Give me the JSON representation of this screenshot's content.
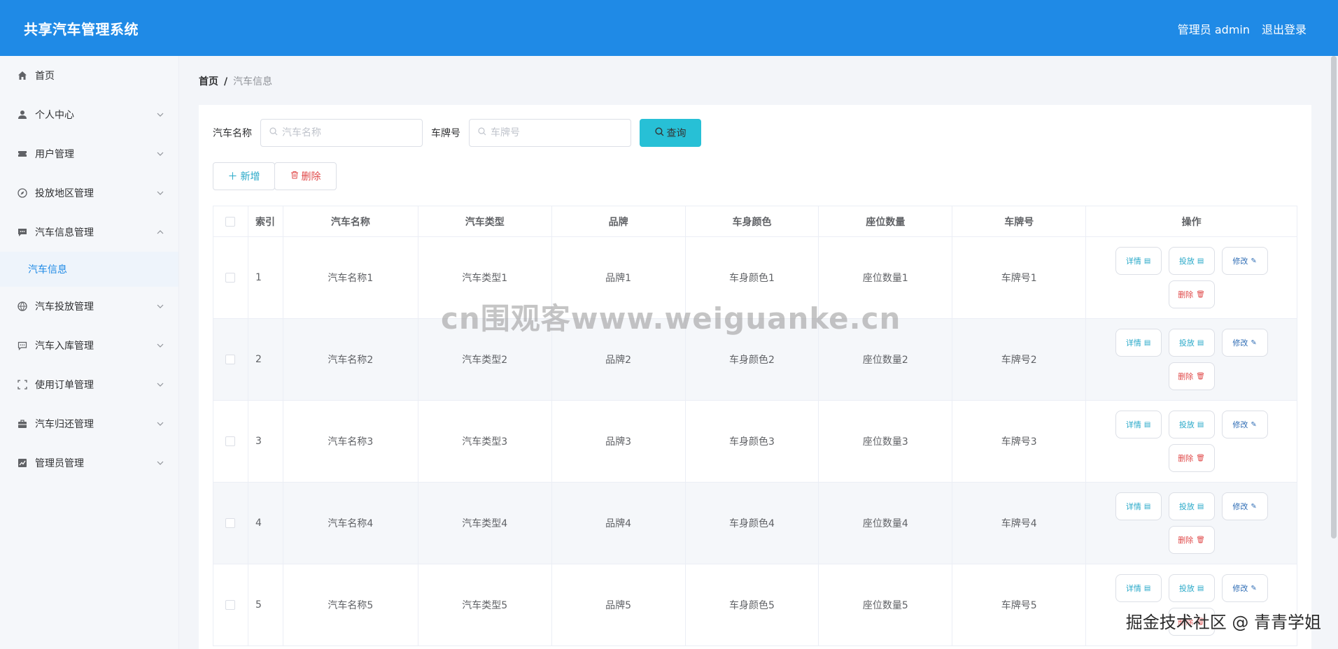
{
  "header": {
    "title": "共享汽车管理系统",
    "user_label": "管理员 admin",
    "logout_label": "退出登录"
  },
  "sidebar": {
    "items": [
      {
        "label": "首页",
        "icon": "home-icon",
        "has_children": false
      },
      {
        "label": "个人中心",
        "icon": "user-icon",
        "has_children": true
      },
      {
        "label": "用户管理",
        "icon": "ticket-icon",
        "has_children": true
      },
      {
        "label": "投放地区管理",
        "icon": "compass-icon",
        "has_children": true
      },
      {
        "label": "汽车信息管理",
        "icon": "chat-icon",
        "has_children": true,
        "expanded": true,
        "children": [
          {
            "label": "汽车信息",
            "active": true
          }
        ]
      },
      {
        "label": "汽车投放管理",
        "icon": "globe-icon",
        "has_children": true
      },
      {
        "label": "汽车入库管理",
        "icon": "comment-icon",
        "has_children": true
      },
      {
        "label": "使用订单管理",
        "icon": "fullscreen-icon",
        "has_children": true
      },
      {
        "label": "汽车归还管理",
        "icon": "briefcase-icon",
        "has_children": true
      },
      {
        "label": "管理员管理",
        "icon": "chart-icon",
        "has_children": true
      }
    ]
  },
  "breadcrumb": {
    "home": "首页",
    "separator": "/",
    "current": "汽车信息"
  },
  "search": {
    "name_label": "汽车名称",
    "name_placeholder": "汽车名称",
    "name_value": "",
    "plate_label": "车牌号",
    "plate_placeholder": "车牌号",
    "plate_value": "",
    "query_label": "查询"
  },
  "actions": {
    "add_label": "新增",
    "delete_label": "删除"
  },
  "table": {
    "columns": [
      "索引",
      "汽车名称",
      "汽车类型",
      "品牌",
      "车身颜色",
      "座位数量",
      "车牌号",
      "操作"
    ],
    "op_labels": {
      "detail": "详情",
      "put": "投放",
      "edit": "修改",
      "remove": "删除"
    },
    "rows": [
      {
        "index": "1",
        "name": "汽车名称1",
        "type": "汽车类型1",
        "brand": "品牌1",
        "color": "车身颜色1",
        "seats": "座位数量1",
        "plate": "车牌号1"
      },
      {
        "index": "2",
        "name": "汽车名称2",
        "type": "汽车类型2",
        "brand": "品牌2",
        "color": "车身颜色2",
        "seats": "座位数量2",
        "plate": "车牌号2"
      },
      {
        "index": "3",
        "name": "汽车名称3",
        "type": "汽车类型3",
        "brand": "品牌3",
        "color": "车身颜色3",
        "seats": "座位数量3",
        "plate": "车牌号3"
      },
      {
        "index": "4",
        "name": "汽车名称4",
        "type": "汽车类型4",
        "brand": "品牌4",
        "color": "车身颜色4",
        "seats": "座位数量4",
        "plate": "车牌号4"
      },
      {
        "index": "5",
        "name": "汽车名称5",
        "type": "汽车类型5",
        "brand": "品牌5",
        "color": "车身颜色5",
        "seats": "座位数量5",
        "plate": "车牌号5"
      }
    ]
  },
  "overlays": {
    "watermark": "cn围观客www.weiguanke.cn",
    "corner": "掘金技术社区 @ 青青学姐"
  },
  "colors": {
    "header_bg": "#1f8ae6",
    "accent": "#27c0d6",
    "danger": "#e04a4a"
  }
}
